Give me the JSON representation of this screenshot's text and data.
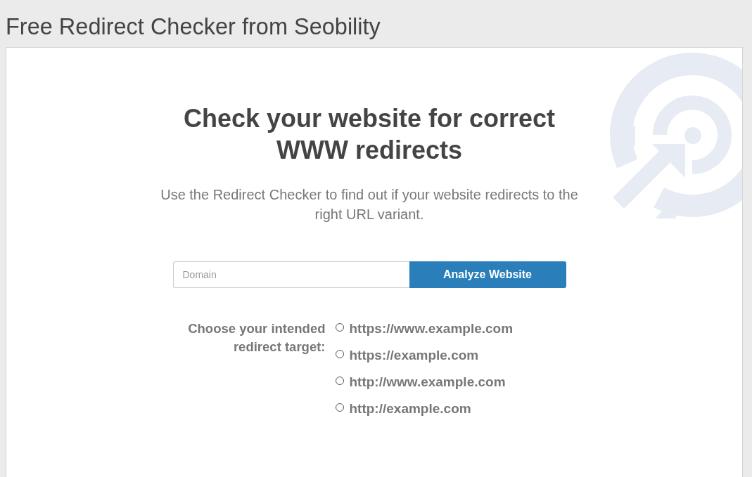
{
  "page_title": "Free Redirect Checker from Seobility",
  "hero": {
    "heading": "Check your website for correct WWW redirects",
    "description": "Use the Redirect Checker to find out if your website redirects to the right URL variant."
  },
  "form": {
    "domain_field": {
      "placeholder": "Domain"
    },
    "submit_button": "Analyze Website"
  },
  "redirect_target": {
    "label": "Choose your intended redirect target:",
    "options": [
      {
        "label": "https://www.example.com",
        "selected": false
      },
      {
        "label": "https://example.com",
        "selected": false
      },
      {
        "label": "http://www.example.com",
        "selected": false
      },
      {
        "label": "http://example.com",
        "selected": false
      }
    ]
  }
}
